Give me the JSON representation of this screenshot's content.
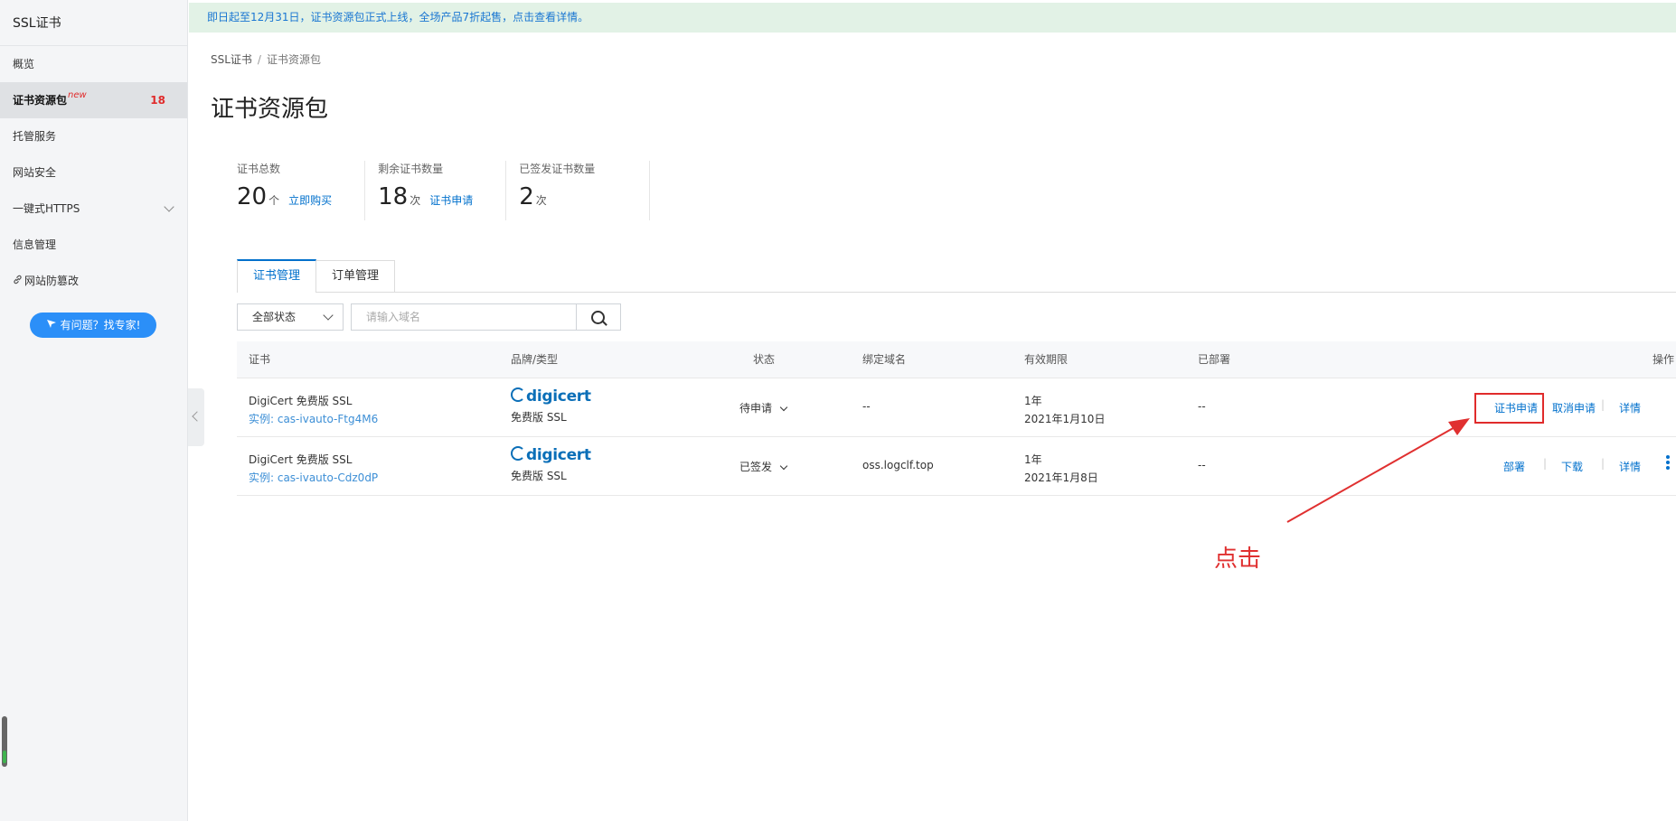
{
  "sidebar": {
    "brand": "SSL证书",
    "items": [
      {
        "label": "概览"
      },
      {
        "label": "证书资源包",
        "tag": "new",
        "badge": "18"
      },
      {
        "label": "托管服务"
      },
      {
        "label": "网站安全"
      },
      {
        "label": "一键式HTTPS"
      },
      {
        "label": "信息管理"
      },
      {
        "label": "网站防篡改"
      }
    ],
    "help_button": "有问题？找专家!"
  },
  "announcement": "即日起至12月31日，证书资源包正式上线，全场产品7折起售，点击查看详情。",
  "breadcrumb": {
    "root": "SSL证书",
    "current": "证书资源包"
  },
  "page_title": "证书资源包",
  "stats": [
    {
      "label": "证书总数",
      "value": "20",
      "unit": "个",
      "link": "立即购买"
    },
    {
      "label": "剩余证书数量",
      "value": "18",
      "unit": "次",
      "link": "证书申请"
    },
    {
      "label": "已签发证书数量",
      "value": "2",
      "unit": "次"
    }
  ],
  "tabs": [
    {
      "label": "证书管理",
      "active": true
    },
    {
      "label": "订单管理",
      "active": false
    }
  ],
  "filters": {
    "status_selected": "全部状态",
    "search_placeholder": "请输入域名"
  },
  "table": {
    "columns": [
      "证书",
      "品牌/类型",
      "状态",
      "绑定域名",
      "有效期限",
      "已部署",
      "操作"
    ],
    "rows": [
      {
        "name": "DigiCert 免费版 SSL",
        "instance": "实例: cas-ivauto-Ftg4M6",
        "brand_logo": "digicert",
        "type": "免费版 SSL",
        "status": "待申请",
        "domain": "--",
        "validity": "1年",
        "date": "2021年1月10日",
        "deployed": "--",
        "actions": [
          "证书申请",
          "取消申请",
          "详情"
        ]
      },
      {
        "name": "DigiCert 免费版 SSL",
        "instance": "实例: cas-ivauto-Cdz0dP",
        "brand_logo": "digicert",
        "type": "免费版 SSL",
        "status": "已签发",
        "domain": "oss.logclf.top",
        "validity": "1年",
        "date": "2021年1月8日",
        "deployed": "--",
        "actions": [
          "部署",
          "下载",
          "详情"
        ]
      }
    ]
  },
  "annotation": "点击",
  "colors": {
    "accent": "#0070cc",
    "annotation": "#e03030",
    "help": "#2b8ff8",
    "banner": "#e2f2e6"
  }
}
